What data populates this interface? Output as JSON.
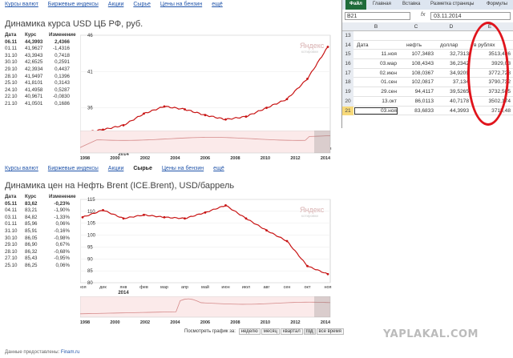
{
  "top_tabs": [
    "Курсы валют",
    "Биржевые индексы",
    "Акции",
    "Сырье",
    "Цены на бензин",
    "ещё"
  ],
  "usd": {
    "title": "Динамика курса USD ЦБ РФ, руб.",
    "headers": [
      "Дата",
      "Курс",
      "Изменение"
    ],
    "rows": [
      {
        "date": "06.11",
        "rate": "44,3993",
        "chg": "2,4366"
      },
      {
        "date": "01.11",
        "rate": "41,9627",
        "chg": "-1,4316"
      },
      {
        "date": "31.10",
        "rate": "43,3943",
        "chg": "0,7418"
      },
      {
        "date": "30.10",
        "rate": "42,6525",
        "chg": "0,2591"
      },
      {
        "date": "29.10",
        "rate": "42,3934",
        "chg": "0,4437"
      },
      {
        "date": "28.10",
        "rate": "41,9497",
        "chg": "0,1396"
      },
      {
        "date": "25.10",
        "rate": "41,8101",
        "chg": "0,3143"
      },
      {
        "date": "24.10",
        "rate": "41,4958",
        "chg": "0,5287"
      },
      {
        "date": "22.10",
        "rate": "40,9671",
        "chg": "-0,0830"
      },
      {
        "date": "21.10",
        "rate": "41,0501",
        "chg": "0,1686"
      }
    ],
    "yticks": [
      "46",
      "41",
      "36",
      "31"
    ],
    "xticks": [
      "ноя",
      "дек",
      "янв",
      "фев",
      "мар",
      "апр",
      "май",
      "июн",
      "июл",
      "авг",
      "сен",
      "окт",
      "ноя"
    ],
    "year": "2014",
    "nav_years": [
      "1998",
      "2000",
      "2002",
      "2004",
      "2006",
      "2008",
      "2010",
      "2012",
      "2014"
    ],
    "logo": "Яндекс",
    "logo_sub": "котировки"
  },
  "mid_tabs": [
    "Курсы валют",
    "Биржевые индексы",
    "Акции",
    "Сырье",
    "Цены на бензин",
    "ещё"
  ],
  "brent": {
    "title": "Динамика цен на Нефть Brent (ICE.Brent), USD/баррель",
    "headers": [
      "Дата",
      "Курс",
      "Изменение"
    ],
    "rows": [
      {
        "date": "05.11",
        "rate": "83,62",
        "chg": "-0,23%"
      },
      {
        "date": "04.11",
        "rate": "83,21",
        "chg": "-1,90%"
      },
      {
        "date": "03.11",
        "rate": "84,82",
        "chg": "-1,33%"
      },
      {
        "date": "01.11",
        "rate": "85,96",
        "chg": "0,06%"
      },
      {
        "date": "31.10",
        "rate": "85,91",
        "chg": "-0,16%"
      },
      {
        "date": "30.10",
        "rate": "86,05",
        "chg": "-0,98%"
      },
      {
        "date": "29.10",
        "rate": "86,90",
        "chg": "0,67%"
      },
      {
        "date": "28.10",
        "rate": "86,32",
        "chg": "-0,68%"
      },
      {
        "date": "27.10",
        "rate": "85,43",
        "chg": "-0,95%"
      },
      {
        "date": "25.10",
        "rate": "86,25",
        "chg": "0,06%"
      }
    ],
    "yticks": [
      "115",
      "110",
      "105",
      "100",
      "95",
      "90",
      "85",
      "80"
    ],
    "xticks": [
      "ноя",
      "дек",
      "янв",
      "фев",
      "мар",
      "апр",
      "май",
      "июн",
      "июл",
      "авг",
      "сен",
      "окт",
      "ноя"
    ],
    "year": "2014",
    "nav_years": [
      "1998",
      "2000",
      "2002",
      "2004",
      "2006",
      "2008",
      "2010",
      "2012",
      "2014"
    ],
    "logo": "Яндекс",
    "logo_sub": "котировки"
  },
  "period": {
    "label": "Посмотреть график за:",
    "buttons": [
      "неделю",
      "месяц",
      "квартал",
      "год",
      "все время"
    ],
    "active": "год"
  },
  "credit": {
    "text": "Данные предоставлены:",
    "source": "Finam.ru"
  },
  "excel": {
    "tabs": [
      "Файл",
      "Главная",
      "Вставка",
      "Разметка страницы",
      "Формулы"
    ],
    "namebox": "B21",
    "fx": "fx",
    "formula": "03.11.2014",
    "columns": [
      "",
      "B",
      "C",
      "D",
      "E"
    ],
    "rows": [
      {
        "n": "13",
        "a": "",
        "b": "",
        "c": "",
        "d": ""
      },
      {
        "n": "14",
        "a": "Дата",
        "b": "нефть",
        "c": "доллар",
        "d": "в рублях",
        "header": true
      },
      {
        "n": "15",
        "a": "11.ноя",
        "b": "107,3483",
        "c": "32,7313",
        "d": "3513,486"
      },
      {
        "n": "16",
        "a": "03.мар",
        "b": "108,4343",
        "c": "36,2342",
        "d": "3929,03"
      },
      {
        "n": "17",
        "a": "02.июн",
        "b": "108,0367",
        "c": "34,9209",
        "d": "3772,728"
      },
      {
        "n": "18",
        "a": "01.сен",
        "b": "102,0817",
        "c": "37,134",
        "d": "3790,732"
      },
      {
        "n": "19",
        "a": "29.сен",
        "b": "94,4117",
        "c": "39,5265",
        "d": "3732,585"
      },
      {
        "n": "20",
        "a": "13.окт",
        "b": "86,0113",
        "c": "40,7178",
        "d": "3502,174"
      },
      {
        "n": "21",
        "a": "03.ноя",
        "b": "83,6833",
        "c": "44,3993",
        "d": "3715,48",
        "selected": true
      }
    ]
  },
  "chart_data": [
    {
      "type": "line",
      "title": "Динамика курса USD ЦБ РФ, руб.",
      "x": [
        "ноя",
        "дек",
        "янв",
        "фев",
        "мар",
        "апр",
        "май",
        "июн",
        "июл",
        "авг",
        "сен",
        "окт",
        "ноя"
      ],
      "values": [
        32.6,
        33.0,
        33.6,
        35.2,
        36.2,
        35.8,
        35.0,
        34.4,
        34.8,
        36.0,
        37.2,
        40.0,
        44.4
      ],
      "ylim": [
        31,
        46
      ],
      "color": "#c81414"
    },
    {
      "type": "line",
      "title": "Динамика цен на Нефть Brent (ICE.Brent), USD/баррель",
      "x": [
        "ноя",
        "дек",
        "янв",
        "фев",
        "мар",
        "апр",
        "май",
        "июн",
        "июл",
        "авг",
        "сен",
        "окт",
        "ноя"
      ],
      "values": [
        107.5,
        110.5,
        107.0,
        108.5,
        107.5,
        107.0,
        109.5,
        112.5,
        107.0,
        102.0,
        97.5,
        87.0,
        83.6
      ],
      "ylim": [
        80,
        115
      ],
      "color": "#c81414"
    }
  ]
}
